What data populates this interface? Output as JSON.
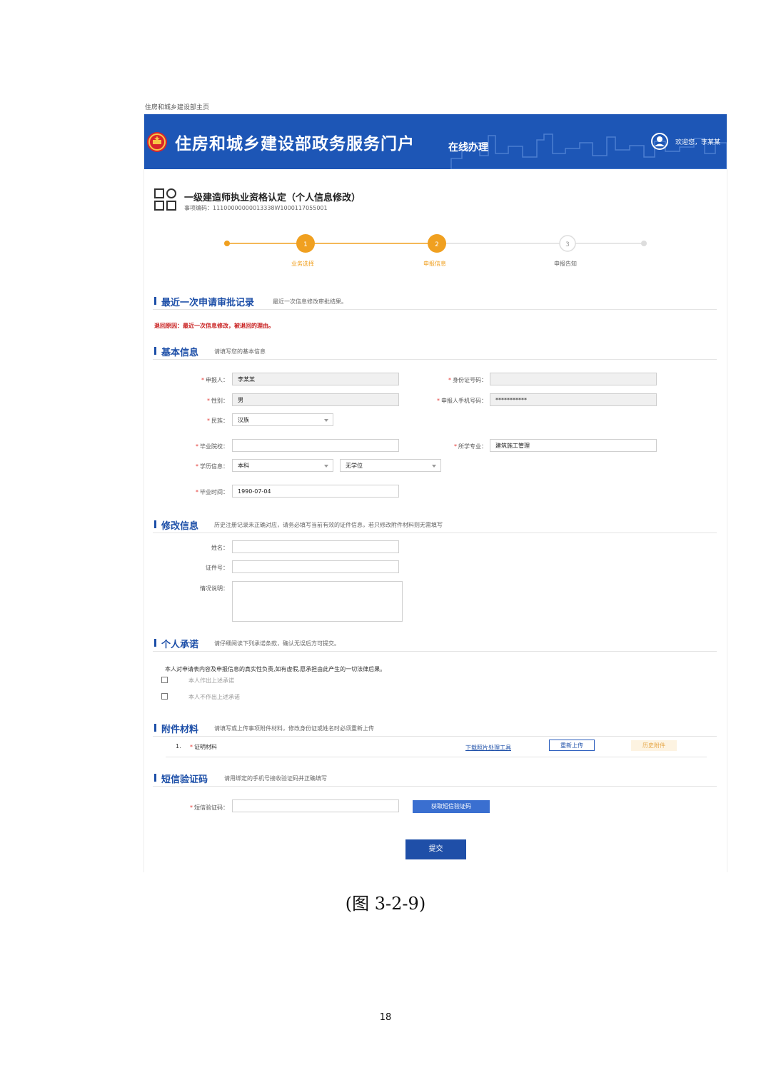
{
  "browser_tab_title": "住房和城乡建设部主页",
  "header": {
    "portal_title": "住房和城乡建设部政务服务门户",
    "online_label": "在线办理",
    "welcome_text": "欢迎您，李某某"
  },
  "service": {
    "title": "一级建造师执业资格认定（个人信息修改）",
    "code": "事项编码：11100000000013338W1000117055001"
  },
  "steps": [
    {
      "number": "1",
      "label": "业务选择",
      "state": "done"
    },
    {
      "number": "2",
      "label": "申报信息",
      "state": "active"
    },
    {
      "number": "3",
      "label": "申报告知",
      "state": "pending"
    }
  ],
  "sections": {
    "latest_record": {
      "title": "最近一次申请审批记录",
      "hint": "最近一次信息修改审批结果。"
    },
    "return_reason": "退回原因：最近一次信息修改，被退回的理由。",
    "basic_info": {
      "title": "基本信息",
      "hint": "请填写您的基本信息"
    },
    "modify_info": {
      "title": "修改信息",
      "hint": "历史注册记录未正确对应，请务必填写当前有效的证件信息，若只修改附件材料则无需填写"
    },
    "pledge": {
      "title": "个人承诺",
      "hint": "请仔细阅读下列承诺条款，确认无误后方可提交。"
    },
    "attachments": {
      "title": "附件材料",
      "hint": "请填写或上传事项附件材料，修改身份证或姓名时必须重新上传"
    },
    "sms": {
      "title": "短信验证码",
      "hint": "请用绑定的手机号接收验证码并正确填写"
    }
  },
  "basic_form": {
    "applicant_label": "申报人：",
    "applicant_value": "李某某",
    "id_label": "身份证号码：",
    "id_value": "",
    "gender_label": "性别：",
    "gender_value": "男",
    "phone_label": "申报人手机号码：",
    "phone_value": "***********",
    "ethnicity_label": "民族：",
    "ethnicity_value": "汉族",
    "school_label": "毕业院校：",
    "school_value": "",
    "major_label": "所学专业：",
    "major_value": "建筑施工管理",
    "education_label": "学历信息：",
    "education_value": "本科",
    "degree_value": "无学位",
    "grad_date_label": "毕业时间：",
    "grad_date_value": "1990-07-04"
  },
  "modify_form": {
    "name_label": "姓名：",
    "idno_label": "证件号：",
    "desc_label": "情况说明："
  },
  "pledge": {
    "text": "本人对申请表内容及申报信息的真实性负责,如有虚假,愿承担由此产生的一切法律后果。",
    "option_agree": "本人作出上述承诺",
    "option_disagree": "本人不作出上述承诺"
  },
  "attachments": {
    "items": [
      {
        "index": "1.",
        "name": "证明材料",
        "download_link": "下载照片处理工具",
        "reupload": "重新上传",
        "history": "历史附件"
      }
    ]
  },
  "sms_form": {
    "label": "短信验证码：",
    "get_code_button": "获取短信验证码"
  },
  "submit_button": "提交",
  "caption": "(图 3-2-9)",
  "page_number": "18",
  "colors": {
    "header_blue": "#1d56b6",
    "section_blue": "#1d4fa8",
    "step_orange": "#f0a020",
    "error_red": "#c81e1e"
  }
}
